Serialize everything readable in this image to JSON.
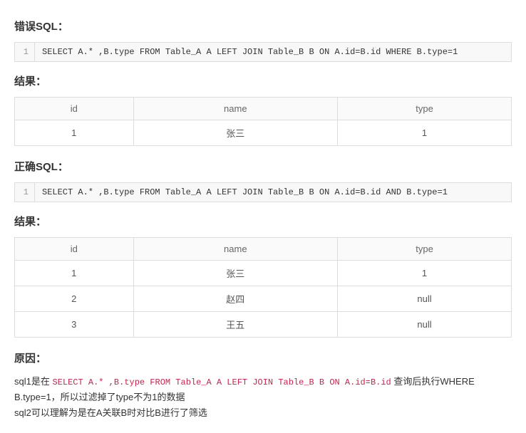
{
  "sections": {
    "wrong_sql_heading": "错误SQL：",
    "result_heading": "结果：",
    "correct_sql_heading": "正确SQL：",
    "reason_heading": "原因："
  },
  "code1": {
    "line_no": "1",
    "text": "SELECT A.* ,B.type FROM Table_A A LEFT JOIN Table_B B ON A.id=B.id WHERE B.type=1"
  },
  "code2": {
    "line_no": "1",
    "text": "SELECT A.* ,B.type FROM Table_A A LEFT JOIN Table_B B ON A.id=B.id AND B.type=1"
  },
  "table_headers": {
    "id": "id",
    "name": "name",
    "type": "type"
  },
  "table1": [
    {
      "id": "1",
      "name": "张三",
      "type": "1"
    }
  ],
  "table2": [
    {
      "id": "1",
      "name": "张三",
      "type": "1"
    },
    {
      "id": "2",
      "name": "赵四",
      "type": "null"
    },
    {
      "id": "3",
      "name": "王五",
      "type": "null"
    }
  ],
  "reason": {
    "prefix1": "sql1是在 ",
    "highlight": "SELECT A.* ,B.type FROM Table_A A LEFT JOIN Table_B B ON A.id=B.id",
    "suffix1": " 查询后执行WHERE B.type=1，所以过滤掉了type不为1的数据",
    "line2": "sql2可以理解为是在A关联B时对比B进行了筛选"
  },
  "chart_data": [
    {
      "type": "table",
      "title": "结果 (错误SQL)",
      "columns": [
        "id",
        "name",
        "type"
      ],
      "rows": [
        [
          "1",
          "张三",
          "1"
        ]
      ]
    },
    {
      "type": "table",
      "title": "结果 (正确SQL)",
      "columns": [
        "id",
        "name",
        "type"
      ],
      "rows": [
        [
          "1",
          "张三",
          "1"
        ],
        [
          "2",
          "赵四",
          "null"
        ],
        [
          "3",
          "王五",
          "null"
        ]
      ]
    }
  ]
}
